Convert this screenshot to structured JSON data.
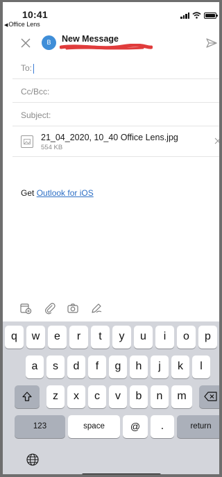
{
  "status": {
    "time": "10:41",
    "back_app": "Office Lens"
  },
  "header": {
    "title": "New Message",
    "avatar_initial": "B"
  },
  "fields": {
    "to_label": "To:",
    "cc_label": "Cc/Bcc:",
    "subject_label": "Subject:"
  },
  "attachment": {
    "name": "21_04_2020, 10_40 Office Lens.jpg",
    "size": "554 KB"
  },
  "body": {
    "sig_prefix": "Get ",
    "sig_link": "Outlook for iOS"
  },
  "toolbar": {
    "icons": [
      "attach-camera-file-icon",
      "paperclip-icon",
      "camera-icon",
      "pen-draw-icon"
    ]
  },
  "keyboard": {
    "row1": [
      "q",
      "w",
      "e",
      "r",
      "t",
      "y",
      "u",
      "i",
      "o",
      "p"
    ],
    "row2": [
      "a",
      "s",
      "d",
      "f",
      "g",
      "h",
      "j",
      "k",
      "l"
    ],
    "row3": [
      "z",
      "x",
      "c",
      "v",
      "b",
      "n",
      "m"
    ],
    "numbers_key": "123",
    "space_key": "space",
    "at_key": "@",
    "dot_key": ".",
    "return_key": "return"
  },
  "colors": {
    "accent": "#3a7bd5",
    "avatar": "#3f8ed8",
    "link": "#2d6fc5",
    "redaction": "#e03c3c",
    "keyboard_bg": "#d3d5db"
  }
}
